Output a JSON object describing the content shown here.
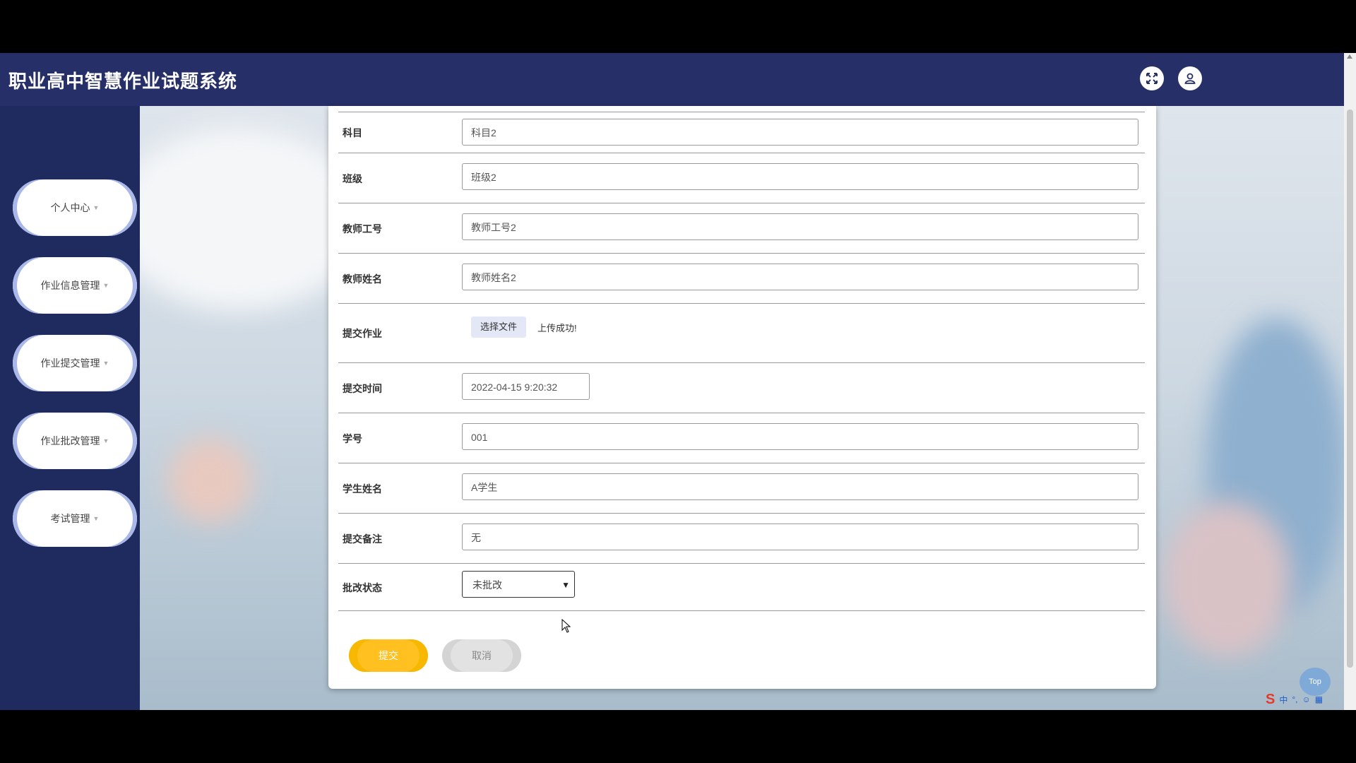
{
  "app": {
    "title": "职业高中智慧作业试题系统",
    "fullscreen_icon": "fullscreen-icon",
    "user_icon": "user-icon"
  },
  "sidebar": {
    "items": [
      {
        "label": "个人中心"
      },
      {
        "label": "作业信息管理"
      },
      {
        "label": "作业提交管理"
      },
      {
        "label": "作业批改管理"
      },
      {
        "label": "考试管理"
      }
    ]
  },
  "form": {
    "fields": {
      "subject": {
        "label": "科目",
        "value": "科目2"
      },
      "class": {
        "label": "班级",
        "value": "班级2"
      },
      "teacher_id": {
        "label": "教师工号",
        "value": "教师工号2"
      },
      "teacher_name": {
        "label": "教师姓名",
        "value": "教师姓名2"
      },
      "submit_homework": {
        "label": "提交作业",
        "button": "选择文件",
        "status": "上传成功!"
      },
      "submit_time": {
        "label": "提交时间",
        "value": "2022-04-15 9:20:32"
      },
      "student_id": {
        "label": "学号",
        "value": "001"
      },
      "student_name": {
        "label": "学生姓名",
        "value": "A学生"
      },
      "remark": {
        "label": "提交备注",
        "value": "无"
      },
      "review_status": {
        "label": "批改状态",
        "value": "未批改"
      }
    },
    "buttons": {
      "submit": "提交",
      "cancel": "取消"
    }
  },
  "floating": {
    "top_label": "Top"
  },
  "tray": {
    "ime": "中"
  },
  "colors": {
    "header": "#262f68",
    "sidebar": "#1f2a5e",
    "submit_button": "#ffc020",
    "cancel_button": "#e2e2e2"
  }
}
